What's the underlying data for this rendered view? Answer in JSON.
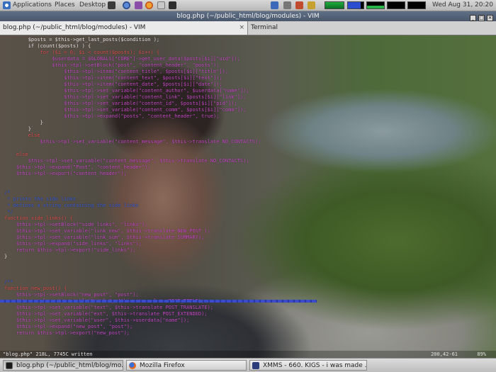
{
  "colors": {
    "vim_keyword": "#e05050",
    "vim_identifier": "#c64bc6",
    "vim_string": "#e83535",
    "vim_comment": "#3b5ed8",
    "vim_plain": "#f0e6e6",
    "statusline": "#3a4cc9"
  },
  "top_panel": {
    "menus": [
      "Applications",
      "Places",
      "Desktop"
    ],
    "clock": "Wed Aug 31, 20:20"
  },
  "window": {
    "title": "blog.php (~/public_html/blog/modules) - VIM"
  },
  "tabs": [
    {
      "label": "blog.php (~/public_html/blog/modules) - VIM",
      "active": true
    },
    {
      "label": "Terminal",
      "active": false
    }
  ],
  "code_lines": [
    {
      "text": "        $posts = $this->get_last_posts($condition );",
      "color": "#f3e9e9"
    },
    {
      "text": "        if (count($posts) ) {",
      "color": "#f3e9e9"
    },
    {
      "text": "            for ($i = 0; $i < count($posts); $i++) {",
      "color": "#e05050"
    },
    {
      "text": "                $userdata = $GLOBALS[\"CORE\"]->get_user_data($posts[$i][\"uid\"]);",
      "color": "#c64bc6"
    },
    {
      "text": "                $this->tpl->setBlock(\"post\", \"content_header\", \"posts\");",
      "color": "#c64bc6"
    },
    {
      "text": "                    $this->tpl->item(\"content_title\", $posts[$i][\"title\"]);",
      "color": "#c64bc6"
    },
    {
      "text": "                    $this->tpl->item(\"content_text\", $posts[$i][\"text\"]);",
      "color": "#c64bc6"
    },
    {
      "text": "                    $this->tpl->item(\"content_date\", $posts[$i][\"date\"]);",
      "color": "#c64bc6"
    },
    {
      "text": "                    $this->tpl->set_variable(\"content_author\", $userdata[\"name\"]);",
      "color": "#c64bc6"
    },
    {
      "text": "                    $this->tpl->set_variable(\"content_link\", $posts[$i][\"link\"]);",
      "color": "#c64bc6"
    },
    {
      "text": "                    $this->tpl->set_variable(\"content_id\", $posts[$i][\"pid\"]);",
      "color": "#c64bc6"
    },
    {
      "text": "                    $this->tpl->set_variable(\"content_comm\", $posts[$i][\"comm\"]);",
      "color": "#c64bc6"
    },
    {
      "text": "                    $this->tpl->expand(\"posts\", \"content_header\", true);",
      "color": "#c64bc6"
    },
    {
      "text": "            }",
      "color": "#f3e9e9"
    },
    {
      "text": "        }",
      "color": "#f3e9e9"
    },
    {
      "text": "        else",
      "color": "#e05050"
    },
    {
      "text": "            $this->tpl->set_variable(\"content_message\", $this->translate NO_CONTACTS);",
      "color": "#c64bc6"
    },
    {
      "text": "",
      "color": "#f3e9e9"
    },
    {
      "text": "    else",
      "color": "#e05050"
    },
    {
      "text": "        $this->tpl->set_variable(\"content_message\", $this->translate NO_CONTACTS);",
      "color": "#c64bc6"
    },
    {
      "text": "    $this->tpl->expand(\"Post\", \"content_header\");",
      "color": "#c64bc6"
    },
    {
      "text": "    $this->tpl->export(\"content_header\");",
      "color": "#c64bc6"
    },
    {
      "text": "",
      "color": "#f3e9e9"
    },
    {
      "text": "",
      "color": "#f3e9e9"
    },
    {
      "text": "/*",
      "color": "#3b5ed8"
    },
    {
      "text": " * prints the side links",
      "color": "#3b5ed8"
    },
    {
      "text": " * defines a string containing the side links",
      "color": "#3b5ed8"
    },
    {
      "text": " */",
      "color": "#3b5ed8"
    },
    {
      "text": "function side_links() {",
      "color": "#e05050"
    },
    {
      "text": "    $this->tpl->setBlock(\"side_links\", \"links\");",
      "color": "#c64bc6"
    },
    {
      "text": "    $this->tpl->set_variable(\"link_new\", $this->translate NEW_POST );",
      "color": "#c64bc6"
    },
    {
      "text": "    $this->tpl->set_variable(\"link_sum\", $this->translate SUMMARY);",
      "color": "#c64bc6"
    },
    {
      "text": "    $this->tpl->expand(\"side_links\", \"links\");",
      "color": "#c64bc6"
    },
    {
      "text": "    return $this->tpl->export(\"side_links\");",
      "color": "#c64bc6"
    },
    {
      "text": "}",
      "color": "#f3e9e9"
    },
    {
      "text": "",
      "color": "#f3e9e9"
    },
    {
      "text": "",
      "color": "#f3e9e9"
    },
    {
      "text": "",
      "color": "#f3e9e9"
    },
    {
      "text": "/**",
      "color": "#3b5ed8"
    },
    {
      "text": "function new_post() {",
      "color": "#e05050"
    },
    {
      "text": "    $this->tpl->setBlock(\"new_post\", \"post\");",
      "color": "#c64bc6"
    },
    {
      "text": "    $this->tpl->set_variable(\"title\", $this->translate POST_TITLE);",
      "color": "#c64bc6"
    },
    {
      "text": "    $this->tpl->set_variable(\"text\", $this->translate POST_TRANSLATE);",
      "color": "#c64bc6"
    },
    {
      "text": "    $this->tpl->set_variable(\"ext\", $this->translate POST_EXTENDED);",
      "color": "#c64bc6"
    },
    {
      "text": "    $this->tpl->set_variable(\"user\", $this->userdata[\"name\"]);",
      "color": "#c64bc6"
    },
    {
      "text": "    $this->tpl->expand(\"new_post\", \"post\");",
      "color": "#c64bc6"
    },
    {
      "text": "    return $this->tpl->export(\"new_post\");",
      "color": "#c64bc6"
    },
    {
      "text": "",
      "color": "#f3e9e9"
    }
  ],
  "vim_status": {
    "file_info": "\"blog.php\" 218L, 7745C written",
    "position": "200,42-61",
    "percent": "89%"
  },
  "taskbar": {
    "items": [
      {
        "label": "blog.php (~/public_html/blog/mo...",
        "icon": "terminal-icon"
      },
      {
        "label": "Mozilla Firefox",
        "icon": "firefox-icon"
      },
      {
        "label": "XMMS - 660. KIGS - i was made ...",
        "icon": "xmms-icon"
      }
    ]
  }
}
